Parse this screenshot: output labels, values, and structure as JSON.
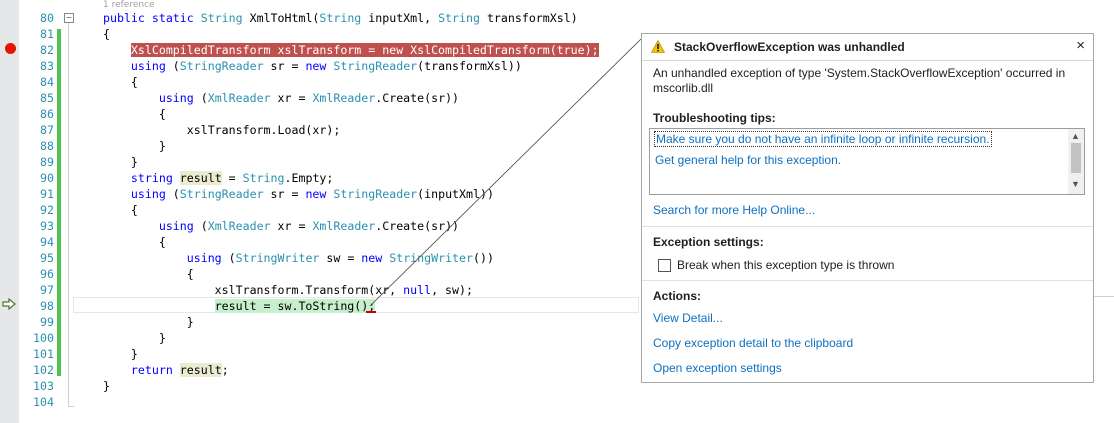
{
  "editor": {
    "reference_hint": "1 reference",
    "lines": [
      {
        "num": "80",
        "tokens": [
          {
            "t": "public static ",
            "c": "kw"
          },
          {
            "t": "String",
            "c": "ty"
          },
          {
            "t": " XmlToHtml("
          },
          {
            "t": "String",
            "c": "ty"
          },
          {
            "t": " inputXml, "
          },
          {
            "t": "String",
            "c": "ty"
          },
          {
            "t": " transformXsl)"
          }
        ]
      },
      {
        "num": "81",
        "tokens": [
          {
            "t": "{"
          }
        ]
      },
      {
        "num": "82",
        "tokens": [
          {
            "t": "    "
          },
          {
            "t": "XslCompiledTransform xslTransform = new XslCompiledTransform(true);",
            "c": "hl-bp"
          }
        ]
      },
      {
        "num": "83",
        "tokens": [
          {
            "t": "    "
          },
          {
            "t": "using",
            "c": "kw"
          },
          {
            "t": " ("
          },
          {
            "t": "StringReader",
            "c": "ty"
          },
          {
            "t": " sr = "
          },
          {
            "t": "new",
            "c": "kw"
          },
          {
            "t": " "
          },
          {
            "t": "StringReader",
            "c": "ty"
          },
          {
            "t": "(transformXsl))"
          }
        ]
      },
      {
        "num": "84",
        "tokens": [
          {
            "t": "    {"
          }
        ]
      },
      {
        "num": "85",
        "tokens": [
          {
            "t": "        "
          },
          {
            "t": "using",
            "c": "kw"
          },
          {
            "t": " ("
          },
          {
            "t": "XmlReader",
            "c": "ty"
          },
          {
            "t": " xr = "
          },
          {
            "t": "XmlReader",
            "c": "ty"
          },
          {
            "t": ".Create(sr))"
          }
        ]
      },
      {
        "num": "86",
        "tokens": [
          {
            "t": "        {"
          }
        ]
      },
      {
        "num": "87",
        "tokens": [
          {
            "t": "            xslTransform.Load(xr);"
          }
        ]
      },
      {
        "num": "88",
        "tokens": [
          {
            "t": "        }"
          }
        ]
      },
      {
        "num": "89",
        "tokens": [
          {
            "t": "    }"
          }
        ]
      },
      {
        "num": "90",
        "tokens": [
          {
            "t": "    "
          },
          {
            "t": "string",
            "c": "kw"
          },
          {
            "t": " "
          },
          {
            "t": "result",
            "c": "hl-hint"
          },
          {
            "t": " = "
          },
          {
            "t": "String",
            "c": "ty"
          },
          {
            "t": ".Empty;"
          }
        ]
      },
      {
        "num": "91",
        "tokens": [
          {
            "t": "    "
          },
          {
            "t": "using",
            "c": "kw"
          },
          {
            "t": " ("
          },
          {
            "t": "StringReader",
            "c": "ty"
          },
          {
            "t": " sr = "
          },
          {
            "t": "new",
            "c": "kw"
          },
          {
            "t": " "
          },
          {
            "t": "StringReader",
            "c": "ty"
          },
          {
            "t": "(inputXml))"
          }
        ]
      },
      {
        "num": "92",
        "tokens": [
          {
            "t": "    {"
          }
        ]
      },
      {
        "num": "93",
        "tokens": [
          {
            "t": "        "
          },
          {
            "t": "using",
            "c": "kw"
          },
          {
            "t": " ("
          },
          {
            "t": "XmlReader",
            "c": "ty"
          },
          {
            "t": " xr = "
          },
          {
            "t": "XmlReader",
            "c": "ty"
          },
          {
            "t": ".Create(sr))"
          }
        ]
      },
      {
        "num": "94",
        "tokens": [
          {
            "t": "        {"
          }
        ]
      },
      {
        "num": "95",
        "tokens": [
          {
            "t": "            "
          },
          {
            "t": "using",
            "c": "kw"
          },
          {
            "t": " ("
          },
          {
            "t": "StringWriter",
            "c": "ty"
          },
          {
            "t": " sw = "
          },
          {
            "t": "new",
            "c": "kw"
          },
          {
            "t": " "
          },
          {
            "t": "StringWriter",
            "c": "ty"
          },
          {
            "t": "())"
          }
        ]
      },
      {
        "num": "96",
        "tokens": [
          {
            "t": "            {"
          }
        ]
      },
      {
        "num": "97",
        "tokens": [
          {
            "t": "                xslTransform.Transform(xr, "
          },
          {
            "t": "null",
            "c": "kw"
          },
          {
            "t": ", sw);"
          }
        ]
      },
      {
        "num": "98",
        "tokens": [
          {
            "t": "                "
          },
          {
            "t": "result = sw.ToString();",
            "c": "hl-cur"
          }
        ]
      },
      {
        "num": "99",
        "tokens": [
          {
            "t": "            }"
          }
        ]
      },
      {
        "num": "100",
        "tokens": [
          {
            "t": "        }"
          }
        ]
      },
      {
        "num": "101",
        "tokens": [
          {
            "t": "    }"
          }
        ]
      },
      {
        "num": "102",
        "tokens": [
          {
            "t": "    "
          },
          {
            "t": "return",
            "c": "kw"
          },
          {
            "t": " "
          },
          {
            "t": "result",
            "c": "hl-hint"
          },
          {
            "t": ";"
          }
        ]
      },
      {
        "num": "103",
        "tokens": [
          {
            "t": "}"
          }
        ]
      },
      {
        "num": "104",
        "tokens": [
          {
            "t": ""
          }
        ]
      }
    ]
  },
  "exception": {
    "title": "StackOverflowException was unhandled",
    "close_label": "×",
    "message": "An unhandled exception of type 'System.StackOverflowException' occurred in mscorlib.dll",
    "troubleshooting_heading": "Troubleshooting tips:",
    "tips": [
      "Make sure you do not have an infinite loop or infinite recursion.",
      "Get general help for this exception."
    ],
    "search_online": "Search for more Help Online...",
    "settings_heading": "Exception settings:",
    "break_checkbox_label": "Break when this exception type is thrown",
    "break_checked": false,
    "actions_heading": "Actions:",
    "actions": [
      "View Detail...",
      "Copy exception detail to the clipboard",
      "Open exception settings"
    ]
  },
  "colors": {
    "keyword": "#0000ff",
    "type": "#2b91af",
    "breakpoint": "#e51400",
    "link": "#0e70c0"
  }
}
